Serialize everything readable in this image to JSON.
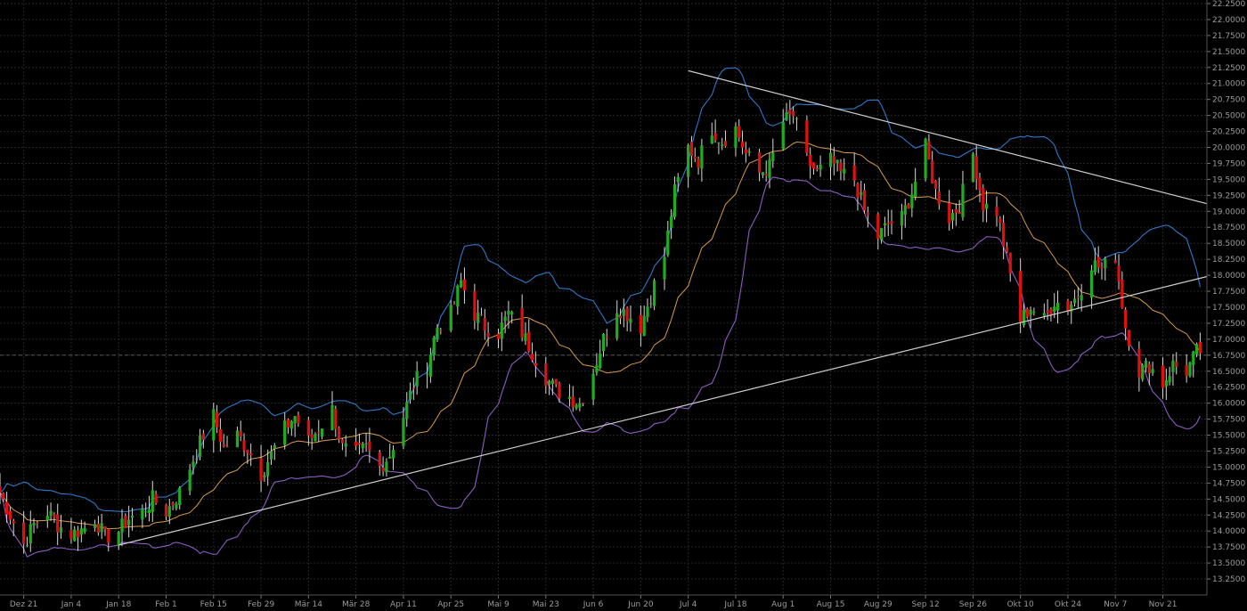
{
  "chart_data": {
    "type": "candlestick",
    "y_axis_side": "right",
    "ylim": [
      13.0,
      22.25
    ],
    "y_ticks": [
      "22.2500",
      "22.0000",
      "21.7500",
      "21.5000",
      "21.2500",
      "21.0000",
      "20.7500",
      "20.5000",
      "20.2500",
      "20.0000",
      "19.7500",
      "19.5000",
      "19.2500",
      "19.0000",
      "18.7500",
      "18.5000",
      "18.2500",
      "18.0000",
      "17.7500",
      "17.5000",
      "17.2500",
      "17.0000",
      "16.7500",
      "16.5000",
      "16.2500",
      "16.0000",
      "15.7500",
      "15.5000",
      "15.2500",
      "15.0000",
      "14.7500",
      "14.5000",
      "14.2500",
      "14.0000",
      "13.7500",
      "13.5000",
      "13.2500"
    ],
    "x_ticks": [
      {
        "label": "Dez 21",
        "day": 7
      },
      {
        "label": "Jan 4",
        "day": 21
      },
      {
        "label": "Jan 18",
        "day": 35
      },
      {
        "label": "Feb 1",
        "day": 49
      },
      {
        "label": "Feb 15",
        "day": 63
      },
      {
        "label": "Feb 29",
        "day": 77
      },
      {
        "label": "Mär 14",
        "day": 91
      },
      {
        "label": "Mär 28",
        "day": 105
      },
      {
        "label": "Apr 11",
        "day": 119
      },
      {
        "label": "Apr 25",
        "day": 133
      },
      {
        "label": "Mai 9",
        "day": 147
      },
      {
        "label": "Mai 23",
        "day": 161
      },
      {
        "label": "Jun 6",
        "day": 175
      },
      {
        "label": "Jun 20",
        "day": 189
      },
      {
        "label": "Jul 4",
        "day": 203
      },
      {
        "label": "Jul 18",
        "day": 217
      },
      {
        "label": "Aug 1",
        "day": 231
      },
      {
        "label": "Aug 15",
        "day": 245
      },
      {
        "label": "Aug 29",
        "day": 259
      },
      {
        "label": "Sep 12",
        "day": 273
      },
      {
        "label": "Sep 26",
        "day": 287
      },
      {
        "label": "Okt 10",
        "day": 301
      },
      {
        "label": "Okt 24",
        "day": 315
      },
      {
        "label": "Nov 7",
        "day": 329
      },
      {
        "label": "Nov 21",
        "day": 343
      }
    ],
    "x_range_days": [
      0,
      356
    ],
    "close_anchors": [
      [
        0,
        14.6
      ],
      [
        3,
        14.25
      ],
      [
        7,
        13.8
      ],
      [
        10,
        14.1
      ],
      [
        14,
        14.3
      ],
      [
        17,
        14.1
      ],
      [
        21,
        13.95
      ],
      [
        25,
        14.05
      ],
      [
        28,
        14.2
      ],
      [
        31,
        13.9
      ],
      [
        35,
        14.0
      ],
      [
        38,
        14.2
      ],
      [
        42,
        14.3
      ],
      [
        45,
        14.5
      ],
      [
        49,
        14.3
      ],
      [
        53,
        14.6
      ],
      [
        56,
        15.0
      ],
      [
        60,
        15.5
      ],
      [
        63,
        15.8
      ],
      [
        66,
        15.3
      ],
      [
        70,
        15.5
      ],
      [
        73,
        15.3
      ],
      [
        77,
        14.9
      ],
      [
        80,
        15.2
      ],
      [
        84,
        15.6
      ],
      [
        87,
        15.8
      ],
      [
        91,
        15.4
      ],
      [
        94,
        15.6
      ],
      [
        98,
        15.9
      ],
      [
        101,
        15.3
      ],
      [
        105,
        15.2
      ],
      [
        108,
        15.3
      ],
      [
        112,
        15.0
      ],
      [
        115,
        15.2
      ],
      [
        119,
        15.8
      ],
      [
        122,
        16.3
      ],
      [
        126,
        16.6
      ],
      [
        129,
        17.2
      ],
      [
        133,
        17.4
      ],
      [
        136,
        17.9
      ],
      [
        140,
        17.4
      ],
      [
        143,
        17.2
      ],
      [
        147,
        17.1
      ],
      [
        150,
        17.4
      ],
      [
        154,
        17.1
      ],
      [
        157,
        16.8
      ],
      [
        161,
        16.4
      ],
      [
        164,
        16.2
      ],
      [
        168,
        16.1
      ],
      [
        171,
        16.0
      ],
      [
        175,
        16.5
      ],
      [
        178,
        17.0
      ],
      [
        182,
        17.5
      ],
      [
        185,
        17.4
      ],
      [
        189,
        17.2
      ],
      [
        192,
        17.7
      ],
      [
        196,
        18.3
      ],
      [
        199,
        19.3
      ],
      [
        203,
        20.0
      ],
      [
        206,
        19.8
      ],
      [
        210,
        20.3
      ],
      [
        213,
        20.1
      ],
      [
        217,
        20.3
      ],
      [
        220,
        19.9
      ],
      [
        224,
        19.6
      ],
      [
        227,
        19.7
      ],
      [
        231,
        20.4
      ],
      [
        234,
        20.5
      ],
      [
        238,
        19.8
      ],
      [
        241,
        19.6
      ],
      [
        245,
        19.8
      ],
      [
        248,
        19.6
      ],
      [
        252,
        19.5
      ],
      [
        255,
        19.0
      ],
      [
        259,
        18.6
      ],
      [
        262,
        18.8
      ],
      [
        266,
        18.9
      ],
      [
        269,
        19.3
      ],
      [
        273,
        20.0
      ],
      [
        276,
        19.3
      ],
      [
        280,
        18.9
      ],
      [
        283,
        19.1
      ],
      [
        287,
        19.9
      ],
      [
        290,
        19.1
      ],
      [
        294,
        19.0
      ],
      [
        298,
        18.0
      ],
      [
        301,
        17.3
      ],
      [
        304,
        17.5
      ],
      [
        308,
        17.3
      ],
      [
        311,
        17.6
      ],
      [
        315,
        17.5
      ],
      [
        318,
        17.7
      ],
      [
        322,
        18.2
      ],
      [
        325,
        18.1
      ],
      [
        329,
        18.3
      ],
      [
        332,
        17.2
      ],
      [
        336,
        16.5
      ],
      [
        339,
        16.6
      ],
      [
        343,
        16.3
      ],
      [
        346,
        16.6
      ],
      [
        350,
        16.5
      ],
      [
        353,
        16.8
      ],
      [
        356,
        16.85
      ]
    ],
    "series": [
      {
        "kind": "sma",
        "color": "#d89a4a"
      },
      {
        "kind": "upper_band",
        "color": "#2f78c8"
      },
      {
        "kind": "lower_band",
        "color": "#8c5cc0"
      }
    ],
    "trendlines": [
      {
        "from": [
          35,
          13.78
        ],
        "to": [
          356,
          17.98
        ],
        "color": "#cccccc"
      },
      {
        "from": [
          203,
          21.2
        ],
        "to": [
          356,
          19.12
        ],
        "color": "#cccccc"
      }
    ],
    "current_level": 16.75,
    "up_color": "#22aa22",
    "down_color": "#dd1111",
    "grid": true
  }
}
